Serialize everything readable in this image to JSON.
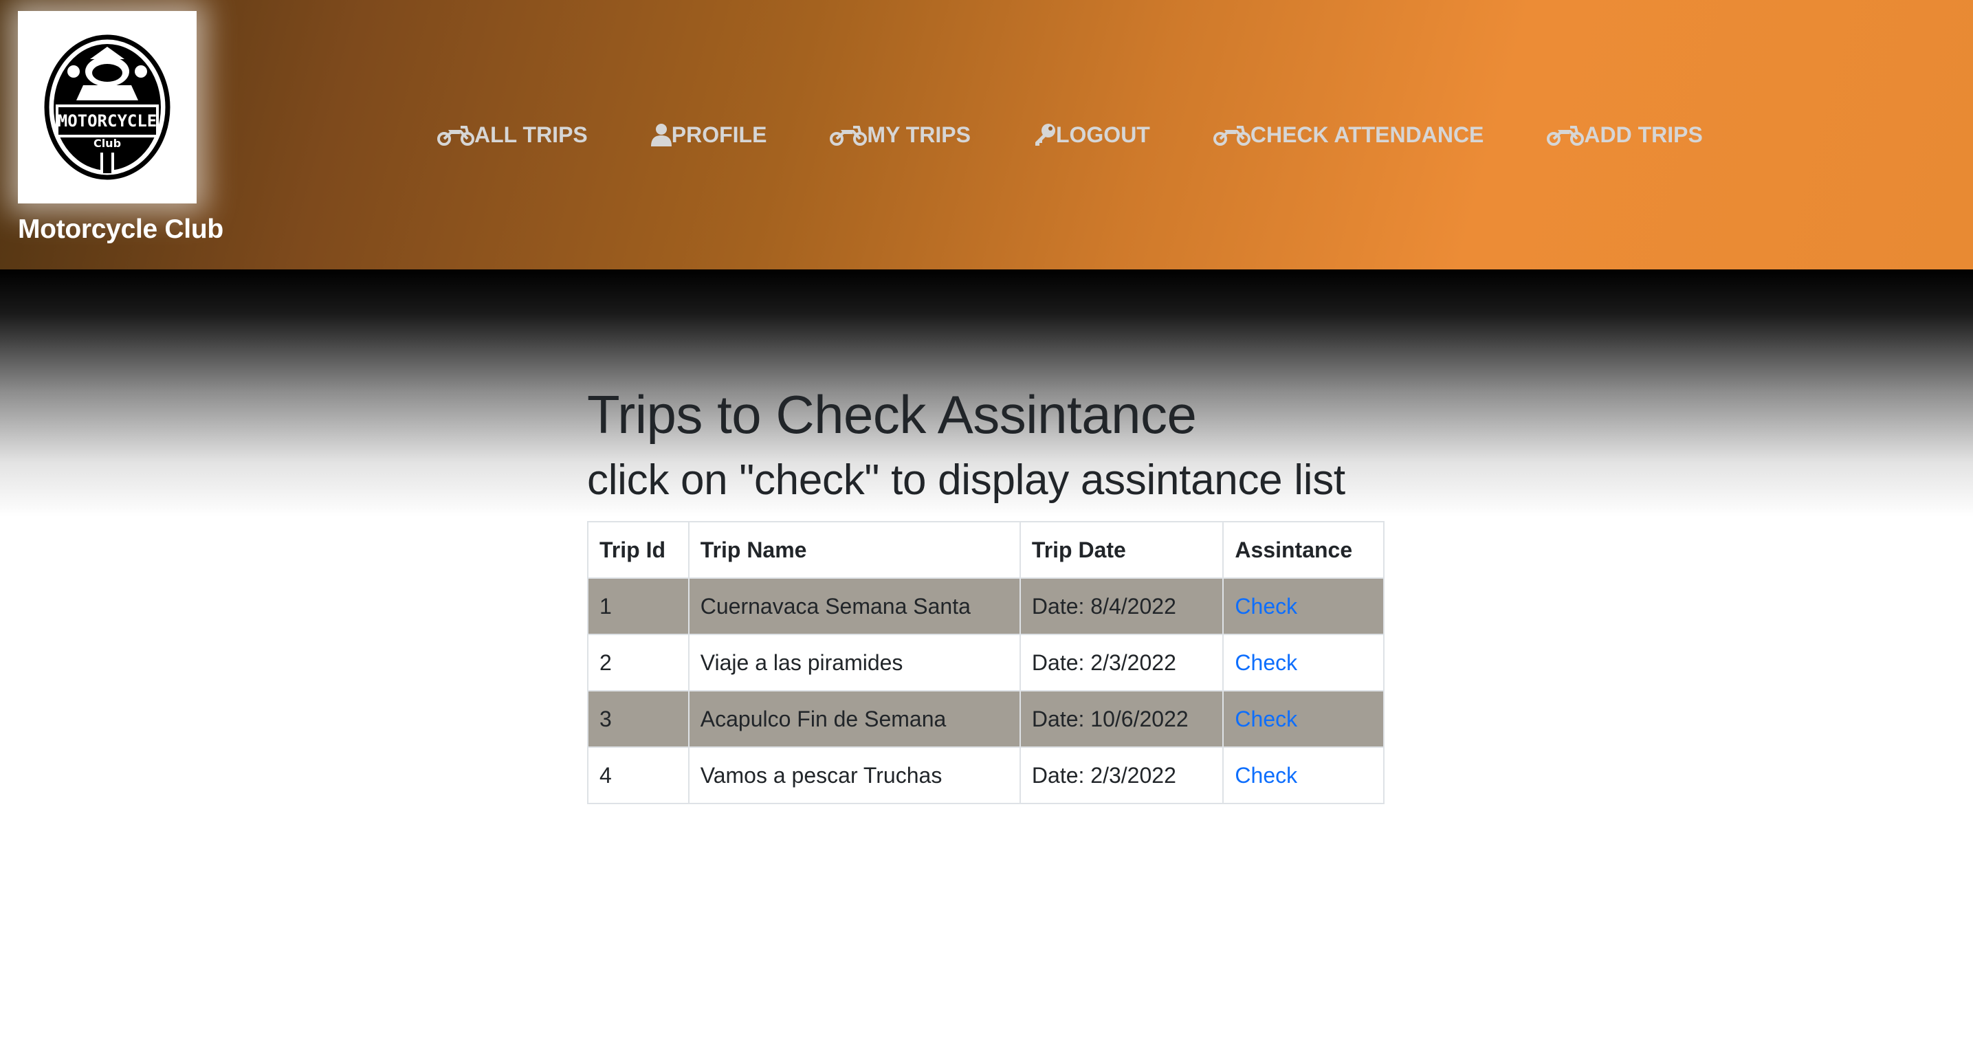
{
  "brand": {
    "logo_line1": "MOTORCYCLE",
    "logo_line2": "Club",
    "name": "Motorcycle Club"
  },
  "nav": {
    "items": [
      {
        "label": "ALL TRIPS",
        "icon": "motorcycle-icon"
      },
      {
        "label": "PROFILE",
        "icon": "user-icon"
      },
      {
        "label": "MY TRIPS",
        "icon": "motorcycle-icon"
      },
      {
        "label": "LOGOUT",
        "icon": "key-icon"
      },
      {
        "label": "CHECK ATTENDANCE",
        "icon": "motorcycle-icon"
      },
      {
        "label": "ADD TRIPS",
        "icon": "motorcycle-icon"
      }
    ]
  },
  "main": {
    "title": "Trips to Check Assintance",
    "subtitle": "click on \"check\" to display assintance list"
  },
  "table": {
    "headers": [
      "Trip Id",
      "Trip Name",
      "Trip Date",
      "Assintance"
    ],
    "rows": [
      {
        "id": "1",
        "name": "Cuernavaca Semana Santa",
        "date": "Date: 8/4/2022",
        "action": "Check"
      },
      {
        "id": "2",
        "name": "Viaje a las piramides",
        "date": "Date: 2/3/2022",
        "action": "Check"
      },
      {
        "id": "3",
        "name": "Acapulco Fin de Semana",
        "date": "Date: 10/6/2022",
        "action": "Check"
      },
      {
        "id": "4",
        "name": "Vamos a pescar Truchas",
        "date": "Date: 2/3/2022",
        "action": "Check"
      }
    ]
  },
  "colors": {
    "header_gradient_start": "#4f3312",
    "header_gradient_end": "#ec8c36",
    "nav_text": "#d6d6d6",
    "striped_row": "#a39e95",
    "link": "#0d6efd"
  }
}
